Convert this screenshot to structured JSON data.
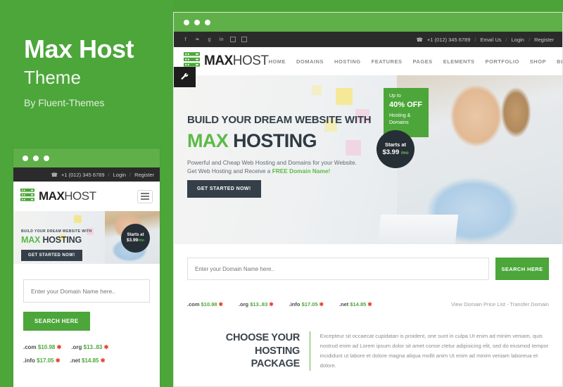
{
  "promo": {
    "title": "Max Host",
    "subtitle": "Theme",
    "author": "By Fluent-Themes",
    "accent_green": "#4ca63a",
    "dark": "#2b2b2b"
  },
  "brand": {
    "name_bold": "MAX",
    "name_light": "HOST",
    "logo_icon": "server-rack-icon"
  },
  "topbar": {
    "social_icons": [
      {
        "name": "facebook-icon",
        "glyph": "f"
      },
      {
        "name": "twitter-icon",
        "glyph": "❧"
      },
      {
        "name": "google-plus-icon",
        "glyph": "g"
      },
      {
        "name": "linkedin-icon",
        "glyph": "in"
      },
      {
        "name": "instagram-icon",
        "glyph": "▣"
      },
      {
        "name": "dribbble-icon",
        "glyph": "ä"
      }
    ],
    "phone": "+1 (012) 345 6789",
    "email_us": "Email Us",
    "login": "Login",
    "register": "Register",
    "separator": "/"
  },
  "nav": {
    "items": [
      {
        "label": "HOME"
      },
      {
        "label": "DOMAINS"
      },
      {
        "label": "HOSTING"
      },
      {
        "label": "FEATURES"
      },
      {
        "label": "PAGES"
      },
      {
        "label": "ELEMENTS"
      },
      {
        "label": "PORTFOLIO"
      },
      {
        "label": "SHOP"
      },
      {
        "label": "BLOG"
      }
    ],
    "tool_icon": "wrench-icon",
    "tool_glyph": "🔧"
  },
  "hero": {
    "kicker": "BUILD YOUR DREAM WEBSITE WITH",
    "title_green": "MAX",
    "title_dark": " HOSTING",
    "paragraph_line1": "Powerful and Cheap Web Hosting and Domains for your Website.",
    "paragraph_line2_pre": "Get Web Hosting and Receive a ",
    "paragraph_line2_green": "FREE Domain Name!",
    "cta_label": "GET STARTED NOW!",
    "offer": {
      "line1": "Up to",
      "line2": "40% OFF",
      "line3": "Hosting &",
      "line4": "Domains"
    },
    "price_badge": {
      "label": "Starts at",
      "amount": "$3.99",
      "period": "/mo"
    }
  },
  "search": {
    "placeholder": "Enter your Domain Name here..",
    "button_label": "SEARCH HERE"
  },
  "domain_prices": [
    {
      "tld": ".com",
      "price": "$10.98",
      "star": "✱"
    },
    {
      "tld": ".org",
      "price": "$13..83",
      "star": "✱"
    },
    {
      "tld": ".info",
      "price": "$17.05",
      "star": "✱"
    },
    {
      "tld": ".net",
      "price": "$14.85",
      "star": "✱"
    }
  ],
  "domain_links": "View Domain Price List - Transfer Domain",
  "package": {
    "heading_line1": "CHOOSE YOUR",
    "heading_line2": "HOSTING PACKAGE",
    "body": "Excepteur sit occaecat cupidatan is proident, one sunt in culpa Ut enim ad minim veniam, quis nostrud enim ad Lorem ipsum dolor sit amet conse ctetur adipisicing elit, sed do eiusmod tempor incididunt ut labore et dolore magna aliqua mollit anim Ut enim ad minim veniam laboreua et dolore."
  },
  "mobile": {
    "hero_kicker": "BUILD YOUR DREAM WEBSITE WITH",
    "hero_title_green": "MAX",
    "hero_title_dark": " HOSTING",
    "cta_label": "GET STARTED NOW!",
    "badge_label": "Starts at",
    "badge_amount": "$3.99",
    "badge_period": "/mo",
    "menu_icon": "hamburger-menu-icon"
  },
  "window_controls": [
    "dot",
    "dot",
    "dot"
  ]
}
